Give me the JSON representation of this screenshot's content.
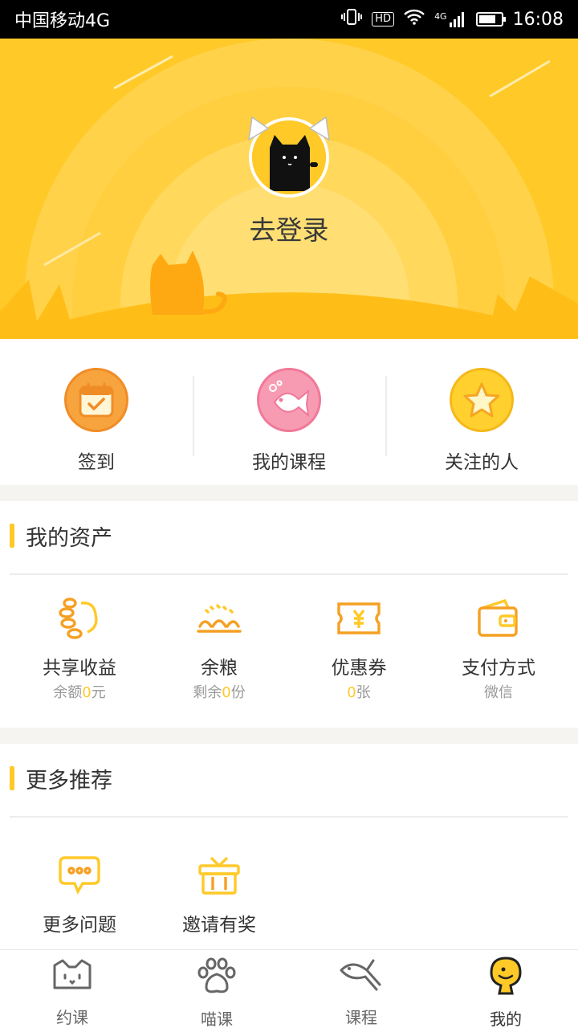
{
  "status_bar": {
    "carrier": "中国移动4G",
    "hd": "HD",
    "network": "4G",
    "time": "16:08"
  },
  "profile": {
    "login_text": "去登录",
    "avatar_icon": "black-cat-avatar"
  },
  "quick_actions": [
    {
      "label": "签到",
      "icon": "calendar-check-icon",
      "color": "#f7a33e"
    },
    {
      "label": "我的课程",
      "icon": "fish-icon",
      "color": "#f79bb3"
    },
    {
      "label": "关注的人",
      "icon": "star-icon",
      "color": "#ffd02e"
    }
  ],
  "assets": {
    "title": "我的资产",
    "items": [
      {
        "name": "共享收益",
        "sub_prefix": "余额",
        "sub_num": "0",
        "sub_suffix": "元",
        "icon": "coins-icon"
      },
      {
        "name": "余粮",
        "sub_prefix": "剩余",
        "sub_num": "0",
        "sub_suffix": "份",
        "icon": "food-icon"
      },
      {
        "name": "优惠券",
        "sub_prefix": "",
        "sub_num": "0",
        "sub_suffix": "张",
        "icon": "coupon-icon"
      },
      {
        "name": "支付方式",
        "sub_prefix": "微信",
        "sub_num": "",
        "sub_suffix": "",
        "icon": "wallet-icon"
      }
    ]
  },
  "more": {
    "title": "更多推荐",
    "items": [
      {
        "name": "更多问题",
        "icon": "chat-bubble-icon"
      },
      {
        "name": "邀请有奖",
        "icon": "gift-icon"
      }
    ]
  },
  "tabs": [
    {
      "label": "约课",
      "icon": "cat-face-icon",
      "active": false
    },
    {
      "label": "喵课",
      "icon": "paw-icon",
      "active": false
    },
    {
      "label": "课程",
      "icon": "fish-outline-icon",
      "active": false
    },
    {
      "label": "我的",
      "icon": "mascot-icon",
      "active": true
    }
  ],
  "colors": {
    "brand": "#ffc928",
    "accent_orange": "#f5a023",
    "text": "#333333",
    "muted": "#999999"
  }
}
